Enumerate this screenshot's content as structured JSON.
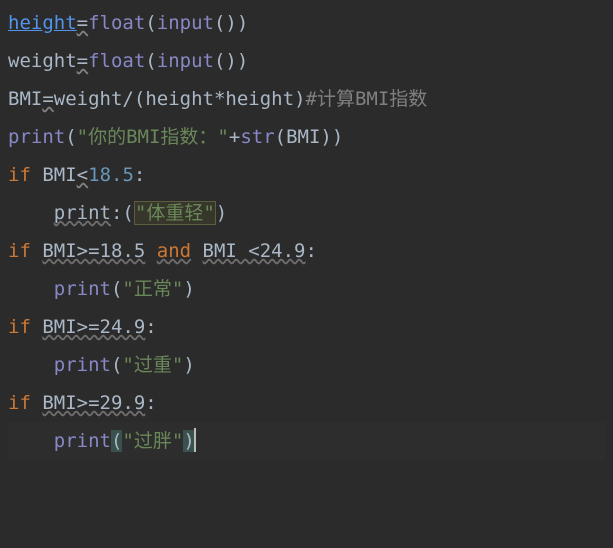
{
  "code": {
    "l1": {
      "height": "height",
      "eq": "=",
      "float": "float",
      "lp": "(",
      "input": "input",
      "args": "()",
      ")": ")"
    },
    "l2": {
      "weight": "weight",
      "eq": "=",
      "float": "float",
      "lp": "(",
      "input": "input",
      "args": "()",
      ")": ")"
    },
    "l3": {
      "bmi": "BMI",
      "eq": "=",
      "weight": "weight",
      "div": "/",
      "lp": "(",
      "height1": "height",
      "mul": "*",
      "height2": "height",
      "rp": ")",
      "comment": "#计算BMI指数"
    },
    "l4": {
      "print": "print",
      "lp": "(",
      "s1": "\"你的BMI指数：\"",
      "plus": "+",
      "str": "str",
      "lp2": "(",
      "bmi": "BMI",
      "rp2": ")",
      "rp": ")"
    },
    "l5": {
      "if": "if",
      "sp": " ",
      "bmi": "BMI",
      "lt": "<",
      "n": "18.5",
      "colon": ":"
    },
    "l6": {
      "print": "print",
      "colon": ":",
      "lp": "(",
      "s": "\"体重轻\"",
      "rp": ")"
    },
    "l7": {
      "if": "if",
      "sp": " ",
      "c1": "BMI>=18.5",
      "sp2": " ",
      "and": "and",
      "sp3": " ",
      "c2": "BMI <24.9",
      "colon": ":"
    },
    "l8": {
      "print": "print",
      "lp": "(",
      "s": "\"正常\"",
      "rp": ")"
    },
    "l9": {
      "if": "if",
      "sp": " ",
      "cond": "BMI>=24.9",
      "colon": ":"
    },
    "l10": {
      "print": "print",
      "lp": "(",
      "s": "\"过重\"",
      "rp": ")"
    },
    "l11": {
      "if": "if",
      "sp": " ",
      "cond": "BMI>=29.9",
      "colon": ":"
    },
    "l12": {
      "print": "print",
      "lp": "(",
      "s": "\"过胖\"",
      "rp": ")"
    }
  }
}
